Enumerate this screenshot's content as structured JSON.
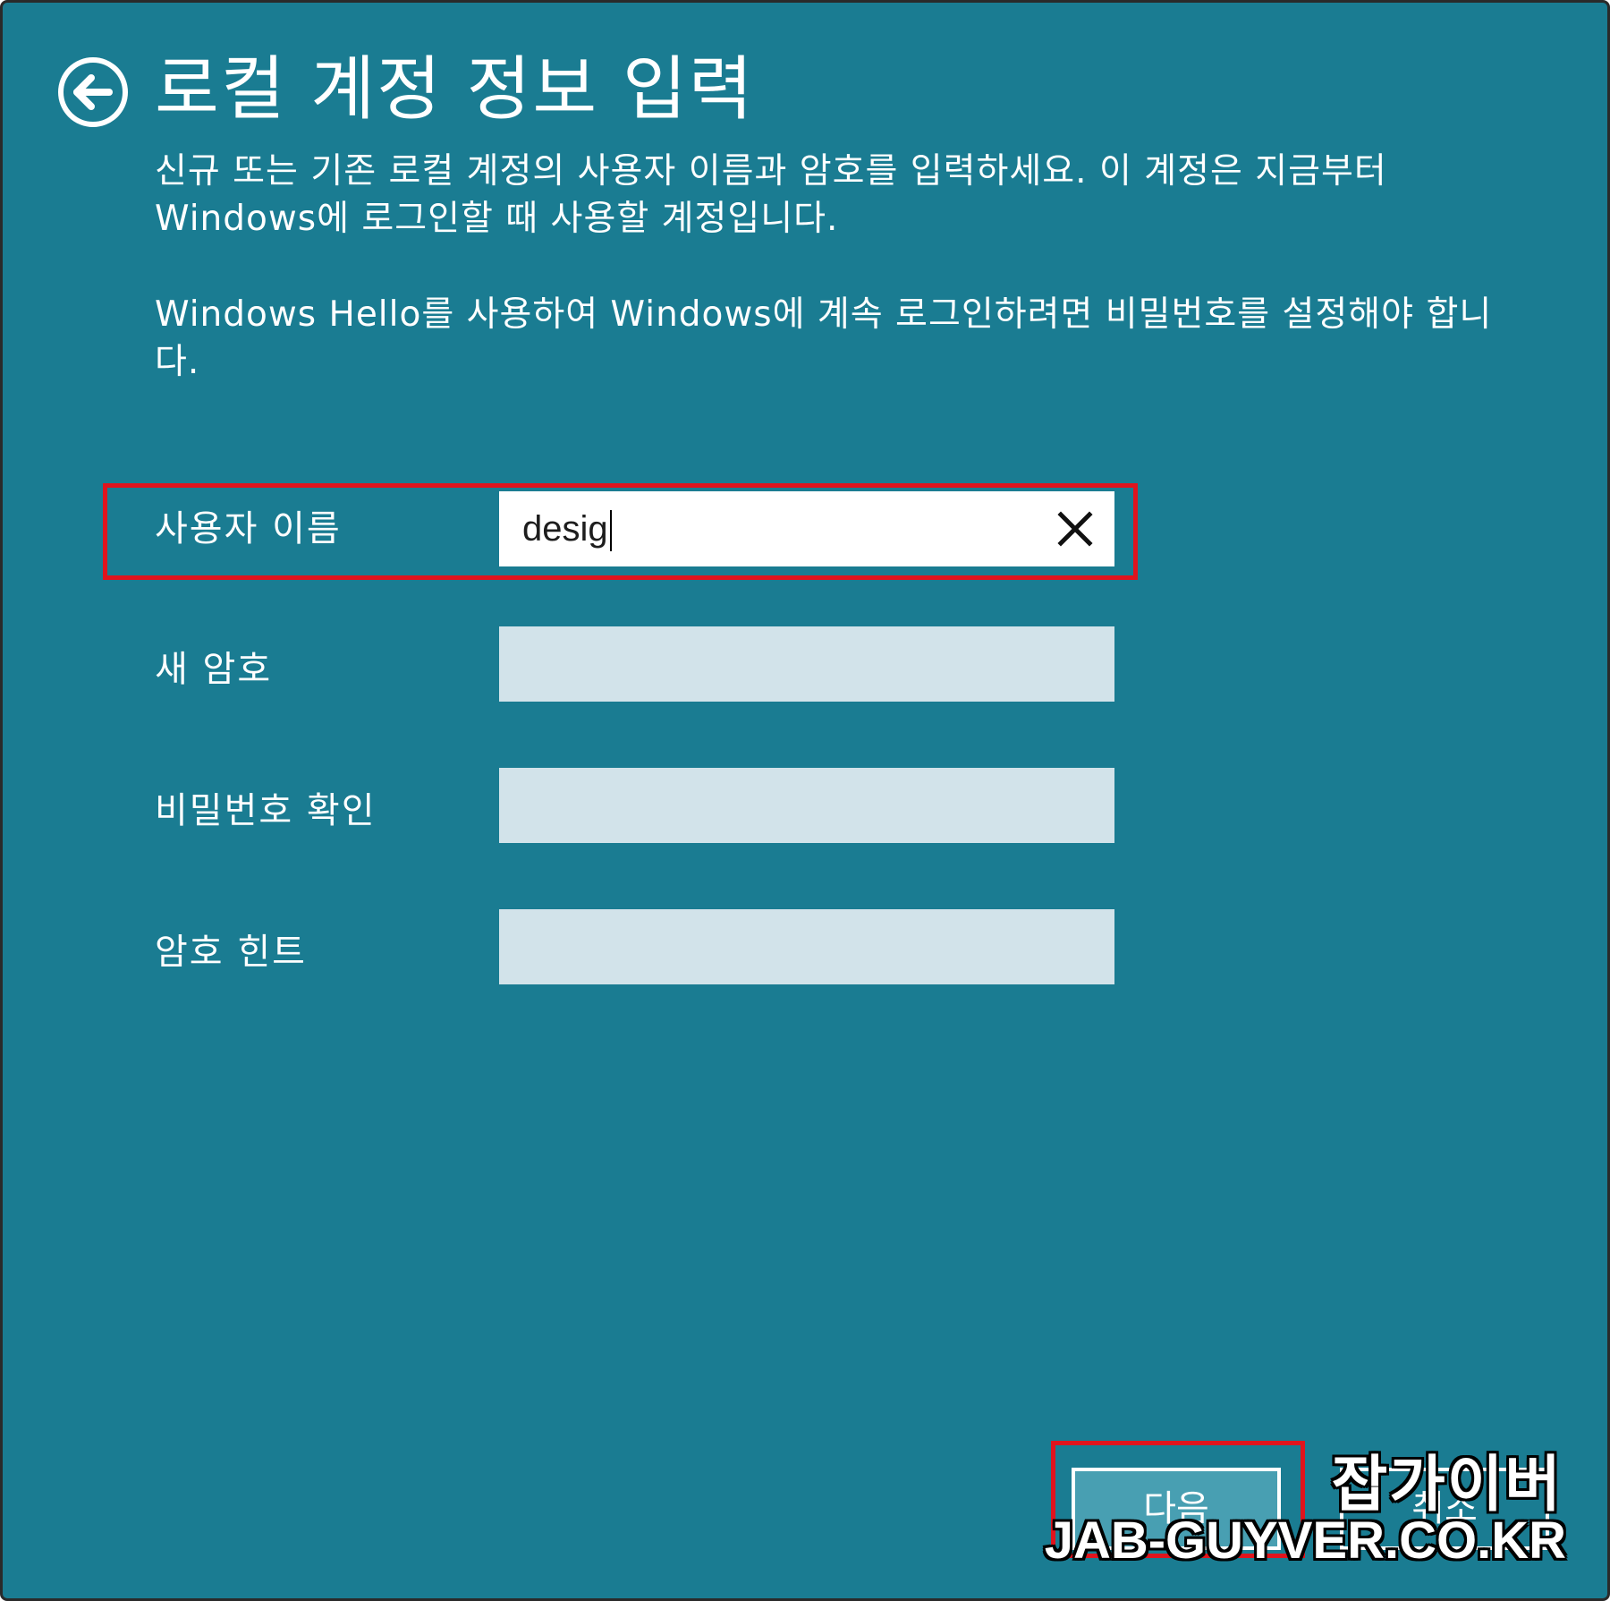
{
  "header": {
    "title": "로컬 계정 정보 입력",
    "back_icon": "back-arrow-circle-icon"
  },
  "description": {
    "paragraph1": "신규 또는 기존 로컬 계정의 사용자 이름과 암호를 입력하세요. 이 계정은 지금부터 Windows에 로그인할 때 사용할 계정입니다.",
    "paragraph2": "Windows Hello를 사용하여 Windows에 계속 로그인하려면 비밀번호를 설정해야 합니다."
  },
  "form": {
    "username": {
      "label": "사용자 이름",
      "value": "desig"
    },
    "new_password": {
      "label": "새 암호",
      "value": ""
    },
    "confirm_password": {
      "label": "비밀번호 확인",
      "value": ""
    },
    "password_hint": {
      "label": "암호 힌트",
      "value": ""
    }
  },
  "buttons": {
    "next_label": "다음",
    "cancel_label": "취소"
  },
  "watermark": {
    "korean": "잡가이버",
    "url": "JAB-GUYVER.CO.KR"
  },
  "colors": {
    "background": "#1a7c92",
    "field_empty": "#d2e3ea",
    "highlight": "#e0141d",
    "next_button": "#489fb2"
  }
}
